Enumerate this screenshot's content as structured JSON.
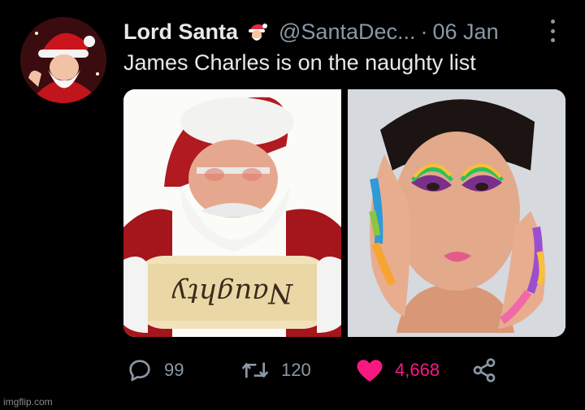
{
  "tweet": {
    "display_name": "Lord Santa",
    "name_emoji_icon": "santa-face-icon",
    "handle": "@SantaDec...",
    "separator": "·",
    "date": "06 Jan",
    "text": "James Charles is on the naughty list",
    "media": [
      {
        "icon": "santa-holding-scroll-image",
        "scroll_text": "Naughty"
      },
      {
        "icon": "rainbow-makeup-portrait-image"
      }
    ],
    "actions": {
      "reply": {
        "icon": "reply-icon",
        "count": "99"
      },
      "retweet": {
        "icon": "retweet-icon",
        "count": "120"
      },
      "like": {
        "icon": "heart-icon",
        "count": "4,668",
        "liked": true
      },
      "share": {
        "icon": "share-icon"
      }
    }
  },
  "colors": {
    "background": "#000000",
    "text_primary": "#e7e9ea",
    "text_secondary": "#8b98a5",
    "like_color": "#f91880"
  },
  "watermark": "imgflip.com"
}
